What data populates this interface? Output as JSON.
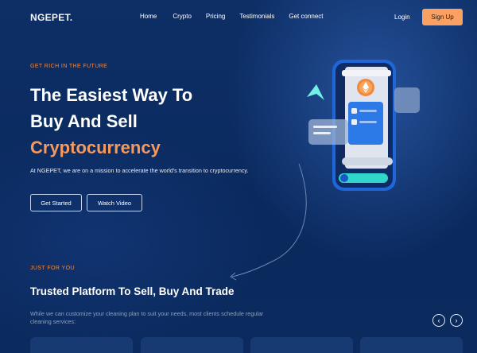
{
  "brand": {
    "name": "NGEPET."
  },
  "nav": {
    "links": [
      "Home",
      "Crypto",
      "Pricing",
      "Testimonials",
      "Get connect"
    ],
    "login": "Login",
    "signup": "Sign Up"
  },
  "hero": {
    "eyebrow": "GET RICH IN THE FUTURE",
    "title_line1": "The Easiest Way To",
    "title_line2": "Buy And Sell",
    "title_accent": "Cryptocurrency",
    "description": "At NGEPET, we are on a mission to accelerate the world's transition to cryptocurrency.",
    "cta_primary": "Get Started",
    "cta_secondary": "Watch Video"
  },
  "section": {
    "eyebrow": "JUST FOR YOU",
    "title": "Trusted Platform To Sell, Buy And Trade",
    "description": "While we can customize your cleaning plan to suit your needs, most clients schedule regular cleaning services:",
    "prev_icon": "chevron-left-icon",
    "next_icon": "chevron-right-icon"
  },
  "colors": {
    "accent": "#f7995c",
    "background": "#0b2b5f",
    "signup_bg": "#f9a062",
    "card_bg": "#173a73"
  }
}
